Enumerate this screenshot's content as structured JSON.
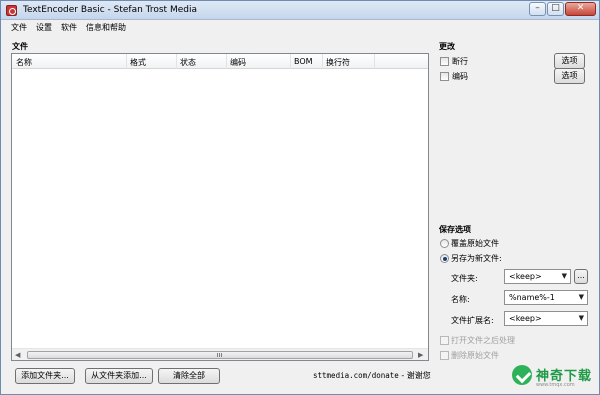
{
  "window": {
    "title": "TextEncoder Basic - Stefan Trost Media",
    "min_glyph": "–",
    "max_glyph": "□",
    "close_glyph": "✕"
  },
  "menu": [
    "文件",
    "设置",
    "软件",
    "信息和帮助"
  ],
  "files_section": {
    "label": "文件",
    "columns": [
      "名称",
      "格式",
      "状态",
      "编码",
      "BOM",
      "换行符"
    ],
    "scroll_left": "◀",
    "scroll_right": "▶"
  },
  "changes_section": {
    "label": "更改",
    "options": [
      {
        "label": "断行",
        "checked": false,
        "button": "选项"
      },
      {
        "label": "编码",
        "checked": false,
        "button": "选项"
      }
    ]
  },
  "save_section": {
    "label": "保存选项",
    "overwrite_label": "覆盖原始文件",
    "save_as_label": "另存为新文件:",
    "folder_label": "文件夹:",
    "folder_value": "<keep>",
    "folder_browse": "...",
    "name_label": "名称:",
    "name_value": "%name%-1",
    "ext_label": "文件扩展名:",
    "ext_value": "<keep>",
    "open_folder_label": "打开文件之后处理",
    "delete_original_label": "删除原始文件",
    "selected": "save_as"
  },
  "bottom": {
    "add_files": "添加文件夹...",
    "add_from_folder": "从文件夹添加...",
    "remove_all": "清除全部",
    "donate_url": "sttmedia.com/donate",
    "donate_text": " - 谢谢您"
  },
  "watermark": {
    "name": "神奇下载",
    "url": "www.tmqx.com"
  },
  "colors": {
    "title_bar": "#c4d6ec",
    "window_bg": "#f0f0f0",
    "watermark_green": "#2db25a"
  }
}
